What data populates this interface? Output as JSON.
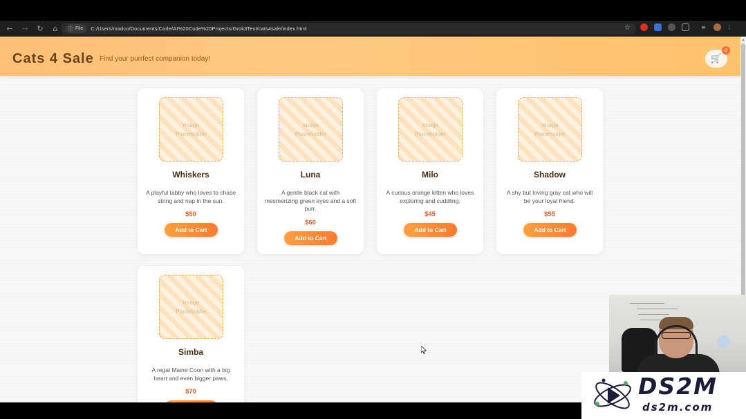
{
  "browser": {
    "url": "C:/Users/madco/Documents/Code/AI%20Code%20Projects/Grok3Test/cats4sale/index.html",
    "site_info_label": "File",
    "nav": {
      "back_icon": "back-arrow-icon",
      "forward_icon": "forward-arrow-icon",
      "reload_icon": "reload-icon",
      "home_icon": "home-icon"
    }
  },
  "header": {
    "brand": "Cats 4 Sale",
    "tagline": "Find your purrfect companion today!",
    "cart_icon": "cart-icon",
    "cart_count": "0",
    "accent_color": "#ffc27a"
  },
  "catalog": {
    "placeholder_line1": "Image",
    "placeholder_line2": "Placeholder",
    "button_label": "Add to Cart",
    "cats": [
      {
        "name": "Whiskers",
        "description": "A playful tabby who loves to chase string and nap in the sun.",
        "price": "$50"
      },
      {
        "name": "Luna",
        "description": "A gentle black cat with mesmerizing green eyes and a soft purr.",
        "price": "$60"
      },
      {
        "name": "Milo",
        "description": "A curious orange kitten who loves exploring and cuddling.",
        "price": "$45"
      },
      {
        "name": "Shadow",
        "description": "A shy but loving gray cat who will be your loyal friend.",
        "price": "$55"
      },
      {
        "name": "Simba",
        "description": "A regal Maine Coon with a big heart and even bigger paws.",
        "price": "$70"
      }
    ]
  },
  "watermark": {
    "main": "DS2M",
    "sub": "ds2m.com"
  }
}
